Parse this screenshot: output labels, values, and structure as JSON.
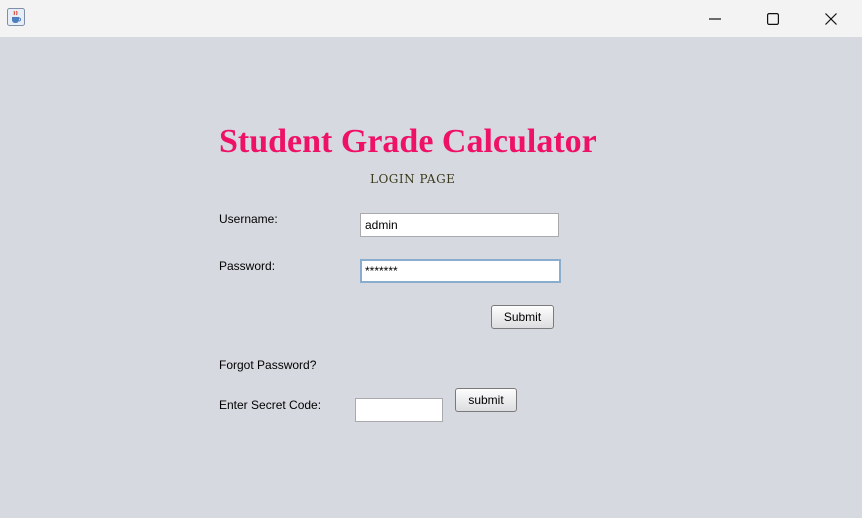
{
  "window": {
    "icon": "java-cup-icon",
    "controls": [
      "minimize-icon",
      "maximize-icon",
      "close-icon"
    ]
  },
  "header": {
    "title": "Student Grade Calculator",
    "subtitle": "LOGIN PAGE",
    "title_color": "#ee1166"
  },
  "login": {
    "username_label": "Username:",
    "username_value": "admin",
    "password_label": "Password:",
    "password_value": "*******",
    "submit_label": "Submit"
  },
  "recovery": {
    "forgot_label": "Forgot Password?",
    "secret_label": "Enter Secret Code:",
    "secret_value": "",
    "submit_label": "submit"
  }
}
